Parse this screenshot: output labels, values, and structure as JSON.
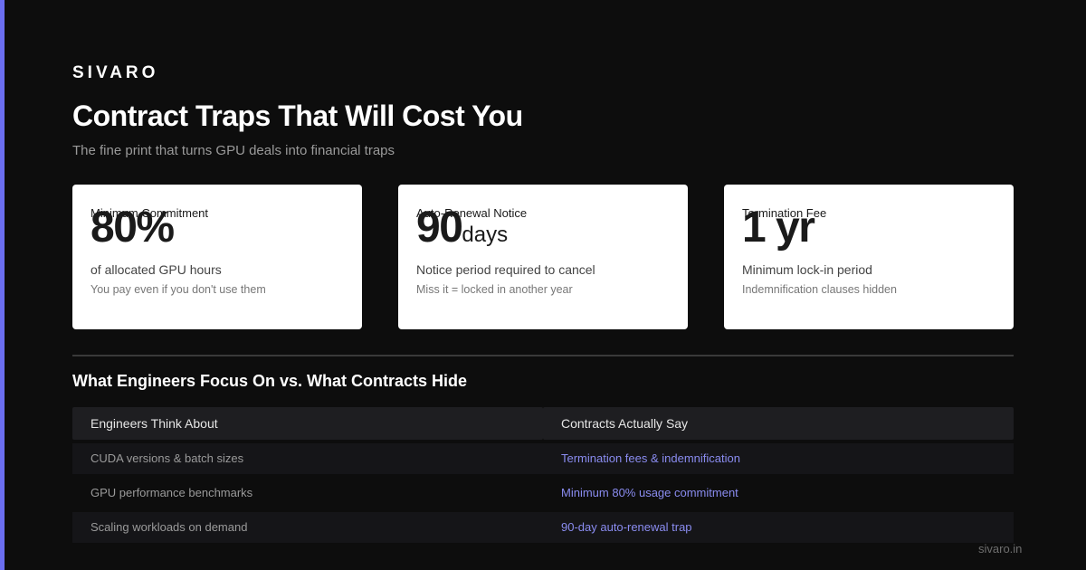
{
  "brand": "SIVARO",
  "header": {
    "title": "Contract Traps That Will Cost You",
    "subtitle": "The fine print that turns GPU deals into financial traps"
  },
  "stats": [
    {
      "label": "Minimum Commitment",
      "value": "80%",
      "unit": "",
      "description": "of allocated GPU hours",
      "note": "You pay even if you don't use them"
    },
    {
      "label": "Auto-Renewal Notice",
      "value": "90",
      "unit": "days",
      "description": "Notice period required to cancel",
      "note": "Miss it = locked in another year"
    },
    {
      "label": "Termination Fee",
      "value": "1 yr",
      "unit": "",
      "description": "Minimum lock-in period",
      "note": "Indemnification clauses hidden"
    }
  ],
  "comparison": {
    "title": "What Engineers Focus On vs. What Contracts Hide",
    "left": {
      "header": "Engineers Think About",
      "items": [
        "CUDA versions & batch sizes",
        "GPU performance benchmarks",
        "Scaling workloads on demand"
      ]
    },
    "right": {
      "header": "Contracts Actually Say",
      "items": [
        "Termination fees & indemnification",
        "Minimum 80% usage commitment",
        "90-day auto-renewal trap"
      ]
    }
  },
  "footer": {
    "url": "sivaro.in"
  },
  "colors": {
    "accent": "#6b6ef0",
    "background": "#0d0d0d",
    "card": "#ffffff",
    "highlight_text": "#8a8cf0"
  }
}
